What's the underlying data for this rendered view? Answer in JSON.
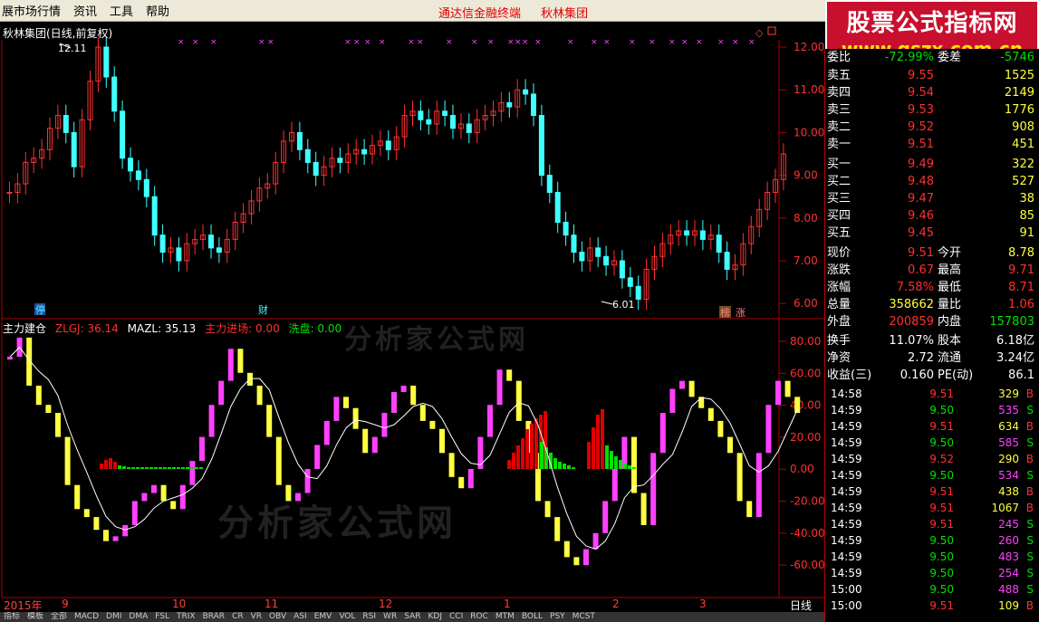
{
  "menu": {
    "items": [
      "展市场行情",
      "资讯",
      "工具",
      "帮助"
    ],
    "center1": "通达信金融终端",
    "center2": "秋林集团"
  },
  "banner": {
    "title": "股票公式指标网",
    "url": "www.gszx.com.cn"
  },
  "chart": {
    "title": "秋林集团(日线,前复权)",
    "high_label": "12.11",
    "low_label": "6.01",
    "y_ticks": [
      "12.00",
      "11.00",
      "10.00",
      "9.00",
      "8.00",
      "7.00",
      "6.00"
    ],
    "markers": [
      "停",
      "财",
      "榜",
      "涨"
    ]
  },
  "indicator": {
    "name": "主力建仓",
    "zlgj": "ZLGJ: 36.14",
    "mazl": "MAZL: 35.13",
    "zljc": "主力进场: 0.00",
    "xp": "洗盘: 0.00",
    "y_ticks": [
      "80.00",
      "60.00",
      "40.00",
      "20.00",
      "0.00",
      "-20.00",
      "-40.00",
      "-60.00"
    ]
  },
  "dates": {
    "year": "2015年",
    "m9": "9",
    "m10": "10",
    "m11": "11",
    "m12": "12",
    "m1": "1",
    "m2": "2",
    "m3": "3",
    "period": "日线"
  },
  "quote": {
    "webi_label": "委比",
    "webi": "-72.99%",
    "wecha_label": "委差",
    "wecha": "-5746",
    "asks": [
      {
        "label": "卖五",
        "price": "9.55",
        "vol": "1525"
      },
      {
        "label": "卖四",
        "price": "9.54",
        "vol": "2149"
      },
      {
        "label": "卖三",
        "price": "9.53",
        "vol": "1776"
      },
      {
        "label": "卖二",
        "price": "9.52",
        "vol": "908"
      },
      {
        "label": "卖一",
        "price": "9.51",
        "vol": "451"
      }
    ],
    "bids": [
      {
        "label": "买一",
        "price": "9.49",
        "vol": "322"
      },
      {
        "label": "买二",
        "price": "9.48",
        "vol": "527"
      },
      {
        "label": "买三",
        "price": "9.47",
        "vol": "38"
      },
      {
        "label": "买四",
        "price": "9.46",
        "vol": "85"
      },
      {
        "label": "买五",
        "price": "9.45",
        "vol": "91"
      }
    ],
    "stats": [
      {
        "l1": "现价",
        "v1": "9.51",
        "l2": "今开",
        "v2": "8.78"
      },
      {
        "l1": "涨跌",
        "v1": "0.67",
        "l2": "最高",
        "v2": "9.71"
      },
      {
        "l1": "涨幅",
        "v1": "7.58%",
        "l2": "最低",
        "v2": "8.71"
      },
      {
        "l1": "总量",
        "v1": "358662",
        "l2": "量比",
        "v2": "1.06"
      },
      {
        "l1": "外盘",
        "v1": "200859",
        "l2": "内盘",
        "v2": "157803"
      }
    ],
    "fin": [
      {
        "l1": "换手",
        "v1": "11.07%",
        "l2": "股本",
        "v2": "6.18亿"
      },
      {
        "l1": "净资",
        "v1": "2.72",
        "l2": "流通",
        "v2": "3.24亿"
      },
      {
        "l1": "收益(三)",
        "v1": "0.160",
        "l2": "PE(动)",
        "v2": "86.1"
      }
    ]
  },
  "ticks": [
    {
      "t": "14:58",
      "p": "9.51",
      "v": "329",
      "bs": "B"
    },
    {
      "t": "14:59",
      "p": "9.50",
      "v": "535",
      "bs": "S"
    },
    {
      "t": "14:59",
      "p": "9.51",
      "v": "634",
      "bs": "B"
    },
    {
      "t": "14:59",
      "p": "9.50",
      "v": "585",
      "bs": "S"
    },
    {
      "t": "14:59",
      "p": "9.52",
      "v": "290",
      "bs": "B"
    },
    {
      "t": "14:59",
      "p": "9.50",
      "v": "534",
      "bs": "S"
    },
    {
      "t": "14:59",
      "p": "9.51",
      "v": "438",
      "bs": "B"
    },
    {
      "t": "14:59",
      "p": "9.51",
      "v": "1067",
      "bs": "B"
    },
    {
      "t": "14:59",
      "p": "9.51",
      "v": "245",
      "bs": "S"
    },
    {
      "t": "14:59",
      "p": "9.50",
      "v": "260",
      "bs": "S"
    },
    {
      "t": "14:59",
      "p": "9.50",
      "v": "483",
      "bs": "S"
    },
    {
      "t": "14:59",
      "p": "9.50",
      "v": "254",
      "bs": "S"
    },
    {
      "t": "15:00",
      "p": "9.50",
      "v": "488",
      "bs": "S"
    },
    {
      "t": "15:00",
      "p": "9.51",
      "v": "109",
      "bs": "B"
    }
  ],
  "tabs": [
    "指标",
    "模板",
    "全部",
    "MACD",
    "DMI",
    "DMA",
    "FSL",
    "TRIX",
    "BRAR",
    "CR",
    "VR",
    "OBV",
    "ASI",
    "EMV",
    "VOL",
    "RSI",
    "WR",
    "SAR",
    "KDJ",
    "CCI",
    "ROC",
    "MTM",
    "BOLL",
    "PSY",
    "MCST"
  ],
  "colors": {
    "up": "#FF3030",
    "down": "#40FFFF",
    "magenta": "#FF40FF",
    "yellow": "#FFFF40"
  }
}
